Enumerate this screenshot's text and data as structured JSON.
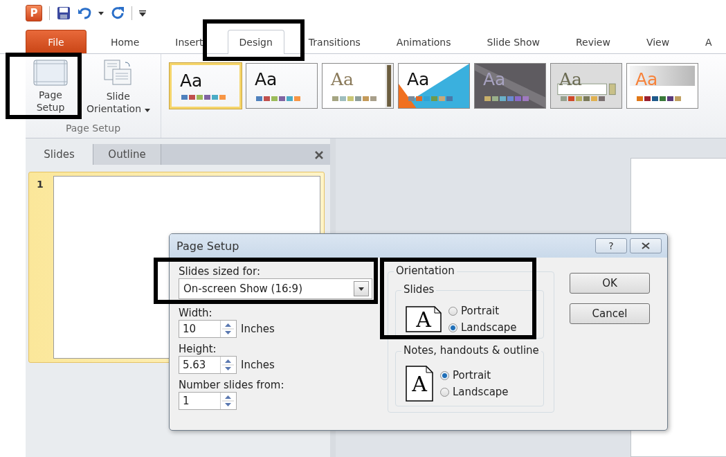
{
  "quick_access": {
    "app_logo": "P"
  },
  "ribbon_tabs": [
    {
      "label": "File",
      "kind": "file",
      "selected": false
    },
    {
      "label": "Home",
      "kind": "tab",
      "selected": false
    },
    {
      "label": "Insert",
      "kind": "tab",
      "selected": false
    },
    {
      "label": "Design",
      "kind": "tab",
      "selected": true
    },
    {
      "label": "Transitions",
      "kind": "tab",
      "selected": false
    },
    {
      "label": "Animations",
      "kind": "tab",
      "selected": false
    },
    {
      "label": "Slide Show",
      "kind": "tab",
      "selected": false
    },
    {
      "label": "Review",
      "kind": "tab",
      "selected": false
    },
    {
      "label": "View",
      "kind": "tab",
      "selected": false
    },
    {
      "label": "A",
      "kind": "tab",
      "selected": false
    }
  ],
  "ribbon_group": {
    "label": "Page Setup",
    "buttons": [
      {
        "lines": [
          "Page",
          "Setup"
        ],
        "kind": "page-setup",
        "dropdown": false
      },
      {
        "lines": [
          "Slide",
          "Orientation"
        ],
        "kind": "orientation",
        "dropdown": true
      }
    ]
  },
  "themes": [
    {
      "label": "Aa",
      "kind": "plain",
      "color": "#111111",
      "selected": true,
      "swatches": [
        {
          "color": "#4f81bd"
        },
        {
          "color": "#c0504d"
        },
        {
          "color": "#9bbb59"
        },
        {
          "color": "#8064a2"
        },
        {
          "color": "#4bacc6"
        },
        {
          "color": "#f79646"
        }
      ]
    },
    {
      "label": "Aa",
      "kind": "plain",
      "color": "#111111",
      "selected": false,
      "swatches": [
        {
          "color": "#4f81bd"
        },
        {
          "color": "#c0504d"
        },
        {
          "color": "#9bbb59"
        },
        {
          "color": "#8064a2"
        },
        {
          "color": "#4bacc6"
        },
        {
          "color": "#f79646"
        }
      ]
    },
    {
      "label": "Aa",
      "kind": "sidebar",
      "color": "#8a7a5a",
      "selected": false,
      "swatches": [
        {
          "color": "#a5a582"
        },
        {
          "color": "#9fbebe"
        },
        {
          "color": "#c9c676"
        },
        {
          "color": "#8e9e9a"
        },
        {
          "color": "#c49a5a"
        },
        {
          "color": "#a89f8a"
        }
      ]
    },
    {
      "label": "Aa",
      "kind": "triangle",
      "color": "#111111",
      "selected": false,
      "swatches": [
        {
          "color": "#7a8a99"
        },
        {
          "color": "#e06a2a"
        },
        {
          "color": "#2ea3d6"
        },
        {
          "color": "#6e9a4a"
        },
        {
          "color": "#c8a878"
        },
        {
          "color": "#4a78a8"
        }
      ]
    },
    {
      "label": "Aa",
      "kind": "dark",
      "color": "#a7a2c0",
      "selected": false,
      "swatches": [
        {
          "color": "#c8b06a"
        },
        {
          "color": "#9ab08a"
        },
        {
          "color": "#6ab0c8"
        },
        {
          "color": "#6a8ad0"
        },
        {
          "color": "#8a6ac8"
        },
        {
          "color": "#a07ac0"
        }
      ]
    },
    {
      "label": "Aa",
      "kind": "bar",
      "color": "#6b6b52",
      "selected": false,
      "swatches": [
        {
          "color": "#96a08e"
        },
        {
          "color": "#d04a2a"
        },
        {
          "color": "#b8b060"
        },
        {
          "color": "#7a7a5a"
        },
        {
          "color": "#e0b050"
        },
        {
          "color": "#7a7070"
        }
      ]
    },
    {
      "label": "Aa",
      "kind": "gradient",
      "color": "#f7823a",
      "selected": false,
      "swatches": [
        {
          "color": "#e07818"
        },
        {
          "color": "#9a2030"
        },
        {
          "color": "#1f5a8a"
        },
        {
          "color": "#3a7a3a"
        },
        {
          "color": "#5a3a7a"
        },
        {
          "color": "#c0a060"
        }
      ]
    }
  ],
  "slides_pane": {
    "tabs": [
      {
        "label": "Slides",
        "selected": true
      },
      {
        "label": "Outline",
        "selected": false
      }
    ],
    "thumbnails": [
      {
        "number": "1",
        "selected": true
      }
    ]
  },
  "dialog": {
    "title": "Page Setup",
    "help": "?",
    "size_label": "Slides sized for:",
    "size_value": "On-screen Show (16:9)",
    "fields": [
      {
        "label": "Width:",
        "value": "10",
        "unit": "Inches"
      },
      {
        "label": "Height:",
        "value": "5.63",
        "unit": "Inches"
      },
      {
        "label": "Number slides from:",
        "value": "1"
      }
    ],
    "orientation": {
      "title": "Orientation",
      "groups": [
        {
          "title": "Slides",
          "kind": "landscape",
          "icon_letter": "A",
          "options": [
            {
              "label": "Portrait",
              "selected": false
            },
            {
              "label": "Landscape",
              "selected": true
            }
          ]
        },
        {
          "title": "Notes, handouts & outline",
          "kind": "portrait",
          "icon_letter": "A",
          "options": [
            {
              "label": "Portrait",
              "selected": true
            },
            {
              "label": "Landscape",
              "selected": false
            }
          ]
        }
      ]
    },
    "buttons": [
      "OK",
      "Cancel"
    ]
  },
  "highlight_boxes": [
    {
      "kind": "page-setup-button"
    },
    {
      "kind": "design-tab"
    },
    {
      "kind": "slide-size"
    },
    {
      "kind": "slide-orientation"
    }
  ]
}
